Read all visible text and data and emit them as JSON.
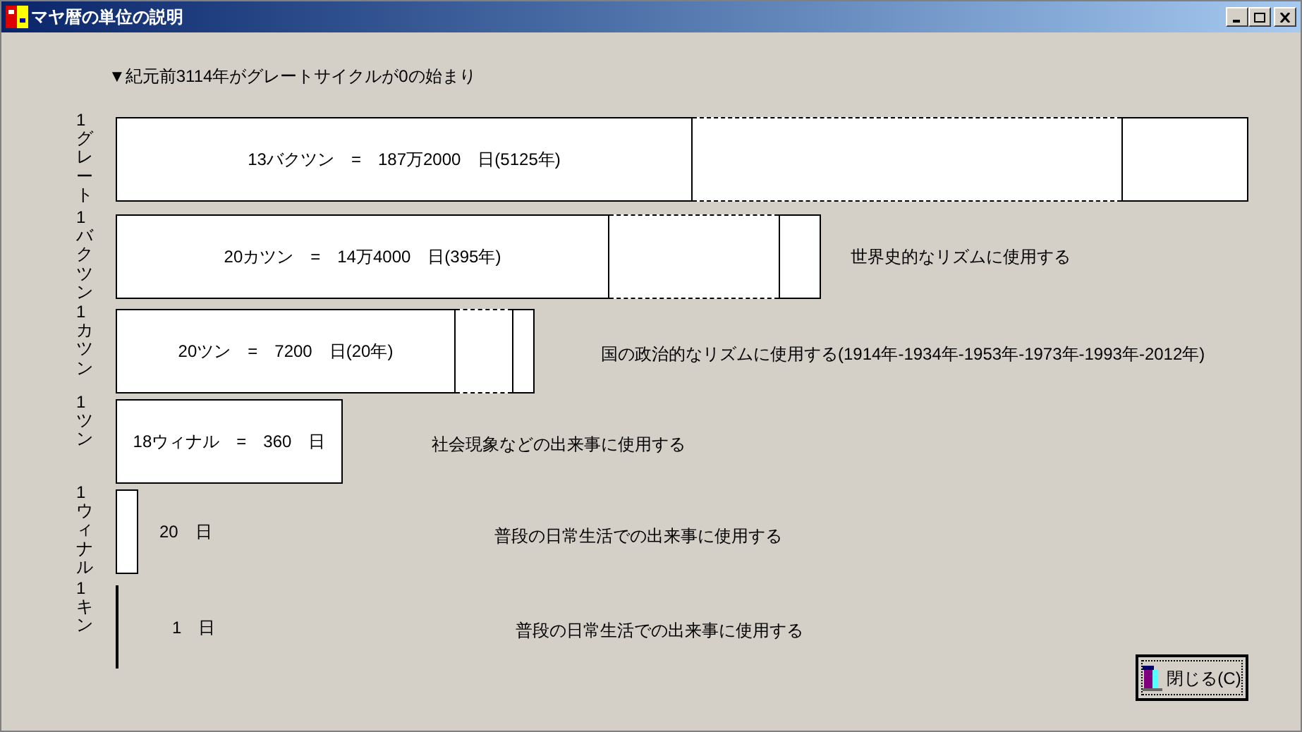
{
  "window": {
    "title": "マヤ暦の単位の説明"
  },
  "heading": "▼紀元前3114年がグレートサイクルが0の始まり",
  "units": [
    {
      "kind": "bar",
      "label": "1グレート",
      "value": "13バクツン　=　187万2000　日(5125年)"
    },
    {
      "kind": "bar",
      "label": "1バクツン",
      "value": "20カツン　=　14万4000　日(395年)",
      "note": "世界史的なリズムに使用する"
    },
    {
      "kind": "bar",
      "label": "1カツン",
      "value": "20ツン　=　7200　日(20年)",
      "note": "国の政治的なリズムに使用する(1914年-1934年-1953年-1973年-1993年-2012年)"
    },
    {
      "kind": "bar",
      "label": "1ツン",
      "value": "18ウィナル　=　360　日",
      "note": "社会現象などの出来事に使用する"
    },
    {
      "kind": "small",
      "label": "1ウィナル",
      "value": "20　日",
      "note": "普段の日常生活での出来事に使用する"
    },
    {
      "kind": "line",
      "label": "1キン",
      "value": "1　日",
      "note": "普段の日常生活での出来事に使用する"
    }
  ],
  "close_button": "閉じる(C)"
}
